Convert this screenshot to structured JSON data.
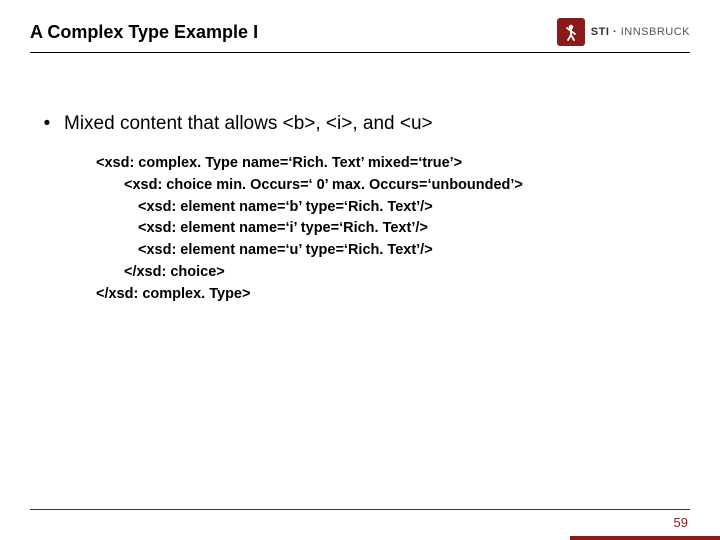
{
  "header": {
    "title": "A Complex Type Example I",
    "logo": {
      "abbrev": "STI",
      "name": "INNSBRUCK"
    }
  },
  "content": {
    "bullet": "Mixed content that allows <b>, <i>, and <u>",
    "code": {
      "l1": "<xsd: complex. Type name=‘Rich. Text’ mixed=‘true’>",
      "l2": "<xsd: choice min. Occurs=‘ 0’ max. Occurs=‘unbounded’>",
      "l3": "<xsd: element name=‘b’ type=‘Rich. Text’/>",
      "l4": "<xsd: element name=‘i’ type=‘Rich. Text’/>",
      "l5": "<xsd: element name=‘u’ type=‘Rich. Text’/>",
      "l6": "</xsd: choice>",
      "l7": "</xsd: complex. Type>"
    }
  },
  "footer": {
    "page_number": "59"
  }
}
